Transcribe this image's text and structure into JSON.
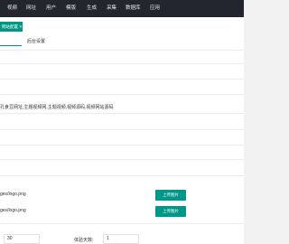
{
  "nav": {
    "items": [
      "视频",
      "网址",
      "用户",
      "模版",
      "生成",
      "采集",
      "数据库",
      "应用"
    ]
  },
  "tab": {
    "label": "网站配置",
    "close_glyph": "✕"
  },
  "subtabs": [
    "",
    "后台设置"
  ],
  "fields": {
    "keywords_value": "孔食豆网址,主题视频网,主题视频,视频源码,视频网站源码",
    "logo_path_1": "ges/logo.png",
    "logo_path_2": "ges/logo.png",
    "upload_label": "上传图片",
    "page_size_value": "30",
    "trial_days_label": "体验天数:",
    "trial_days_value": "1"
  },
  "colors": {
    "topbar": "#23262e",
    "accent": "#009688"
  }
}
